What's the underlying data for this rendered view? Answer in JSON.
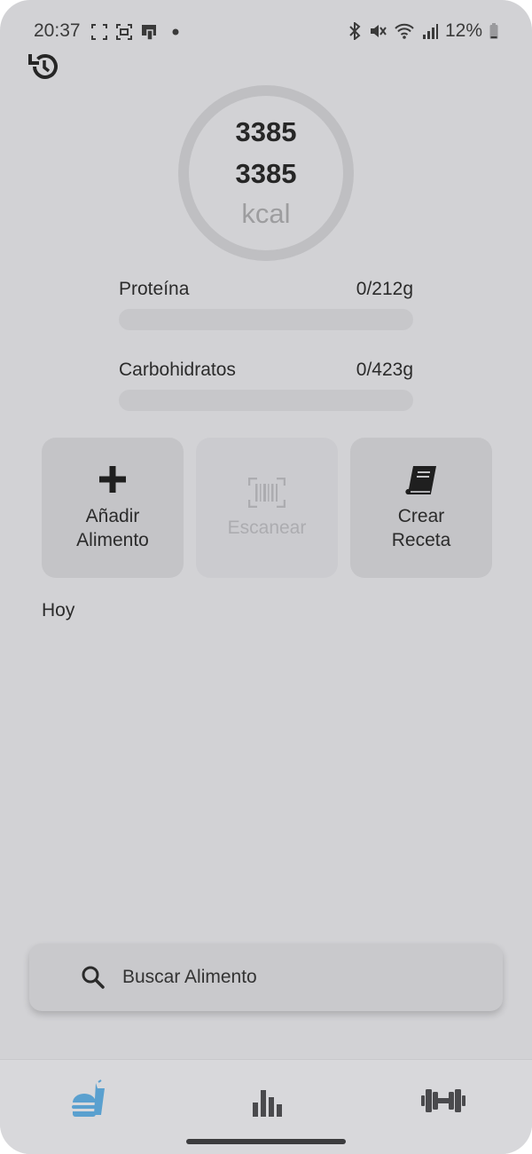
{
  "status_bar": {
    "time": "20:37",
    "battery": "12%",
    "left_icons": [
      "screenshot-frame-icon",
      "screen-record-icon",
      "phone-mirror-icon",
      "dot-icon"
    ],
    "right_icons": [
      "bluetooth-icon",
      "mute-icon",
      "wifi-icon",
      "signal-icon",
      "battery-icon"
    ]
  },
  "header": {
    "history_icon": "history-icon"
  },
  "calorie_ring": {
    "consumed": "3385",
    "target": "3385",
    "unit": "kcal",
    "progress_fraction": 0
  },
  "macros": [
    {
      "name": "Proteína",
      "amount": "0/212g",
      "progress_fraction": 0
    },
    {
      "name": "Carbohidratos",
      "amount": "0/423g",
      "progress_fraction": 0
    }
  ],
  "actions": [
    {
      "label_line1": "Añadir",
      "label_line2": "Alimento",
      "icon": "plus-icon",
      "enabled": true
    },
    {
      "label_line1": "Escanear",
      "label_line2": "",
      "icon": "barcode-scan-icon",
      "enabled": false
    },
    {
      "label_line1": "Crear",
      "label_line2": "Receta",
      "icon": "book-icon",
      "enabled": true
    }
  ],
  "section_title": "Hoy",
  "search": {
    "placeholder": "Buscar Alimento",
    "icon": "search-icon"
  },
  "bottom_nav": {
    "items": [
      {
        "icon": "food-burger-drink-icon",
        "active": true
      },
      {
        "icon": "bar-chart-icon",
        "active": false
      },
      {
        "icon": "dumbbell-icon",
        "active": false
      }
    ],
    "active_color": "#5aa0cf",
    "inactive_color": "#4a4a4d"
  }
}
